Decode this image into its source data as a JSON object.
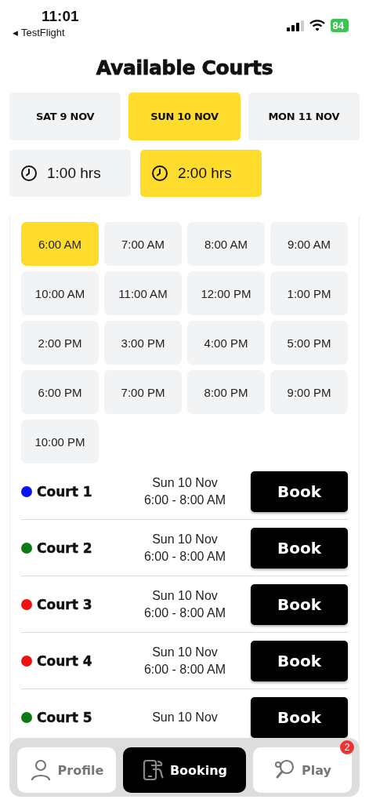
{
  "status_bar": {
    "time": "11:01",
    "back_arrow": "◀",
    "back_app": "TestFlight",
    "battery": "84"
  },
  "title": "Available Courts",
  "dates": [
    {
      "label": "SAT 9 NOV",
      "selected": false
    },
    {
      "label": "SUN 10 NOV",
      "selected": true
    },
    {
      "label": "MON 11 NOV",
      "selected": false
    }
  ],
  "durations": [
    {
      "label": "1:00 hrs",
      "selected": false
    },
    {
      "label": "2:00 hrs",
      "selected": true
    }
  ],
  "time_slots": [
    {
      "label": "6:00 AM",
      "selected": true
    },
    {
      "label": "7:00 AM",
      "selected": false
    },
    {
      "label": "8:00 AM",
      "selected": false
    },
    {
      "label": "9:00 AM",
      "selected": false
    },
    {
      "label": "10:00 AM",
      "selected": false
    },
    {
      "label": "11:00 AM",
      "selected": false
    },
    {
      "label": "12:00 PM",
      "selected": false
    },
    {
      "label": "1:00 PM",
      "selected": false
    },
    {
      "label": "2:00 PM",
      "selected": false
    },
    {
      "label": "3:00 PM",
      "selected": false
    },
    {
      "label": "4:00 PM",
      "selected": false
    },
    {
      "label": "5:00 PM",
      "selected": false
    },
    {
      "label": "6:00 PM",
      "selected": false
    },
    {
      "label": "7:00 PM",
      "selected": false
    },
    {
      "label": "8:00 PM",
      "selected": false
    },
    {
      "label": "9:00 PM",
      "selected": false
    },
    {
      "label": "10:00 PM",
      "selected": false
    }
  ],
  "courts": [
    {
      "name": "Court 1",
      "color": "#0a14f0",
      "date": "Sun 10 Nov",
      "time": "6:00 - 8:00 AM",
      "button": "Book"
    },
    {
      "name": "Court 2",
      "color": "#0e7a12",
      "date": "Sun 10 Nov",
      "time": "6:00 - 8:00 AM",
      "button": "Book"
    },
    {
      "name": "Court 3",
      "color": "#f01010",
      "date": "Sun 10 Nov",
      "time": "6:00 - 8:00 AM",
      "button": "Book"
    },
    {
      "name": "Court 4",
      "color": "#f01010",
      "date": "Sun 10 Nov",
      "time": "6:00 - 8:00 AM",
      "button": "Book"
    },
    {
      "name": "Court 5",
      "color": "#0e7a12",
      "date": "Sun 10 Nov",
      "button": "Book"
    }
  ],
  "tab_bar": [
    {
      "label": "Profile",
      "selected": false
    },
    {
      "label": "Booking",
      "selected": true
    },
    {
      "label": "Play",
      "selected": false,
      "badge": "2"
    }
  ]
}
